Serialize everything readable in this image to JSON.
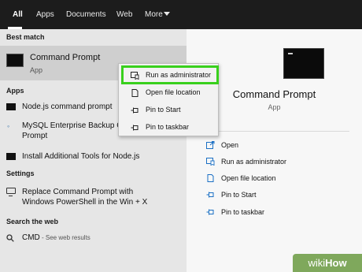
{
  "tabs": [
    {
      "label": "All"
    },
    {
      "label": "Apps"
    },
    {
      "label": "Documents"
    },
    {
      "label": "Web"
    },
    {
      "label": "More"
    }
  ],
  "sections": {
    "best_match": "Best match",
    "apps": "Apps",
    "settings": "Settings",
    "search_web": "Search the web"
  },
  "best_match": {
    "title": "Command Prompt",
    "subtitle": "App"
  },
  "apps": [
    {
      "label": "Node.js command prompt",
      "icon": "console-icon"
    },
    {
      "line1": "MySQL Enterprise Backup Co",
      "line2": "Prompt",
      "icon": "mysql-icon"
    },
    {
      "label": "Install Additional Tools for Node.js",
      "icon": "console-icon"
    }
  ],
  "settings": {
    "line1": "Replace Command Prompt with",
    "line2": "Windows PowerShell in the Win + X",
    "icon": "monitor-icon"
  },
  "web": {
    "query": "CMD",
    "suffix": " - See web results",
    "icon": "search-icon"
  },
  "context_menu": [
    {
      "label": "Run as administrator",
      "icon": "shield-run-icon"
    },
    {
      "label": "Open file location",
      "icon": "document-icon"
    },
    {
      "label": "Pin to Start",
      "icon": "pin-icon"
    },
    {
      "label": "Pin to taskbar",
      "icon": "pin-icon"
    }
  ],
  "preview": {
    "title": "Command Prompt",
    "subtitle": "App"
  },
  "actions": [
    {
      "label": "Open",
      "icon": "open-icon"
    },
    {
      "label": "Run as administrator",
      "icon": "shield-run-icon"
    },
    {
      "label": "Open file location",
      "icon": "document-icon"
    },
    {
      "label": "Pin to Start",
      "icon": "pin-icon"
    },
    {
      "label": "Pin to taskbar",
      "icon": "pin-icon"
    }
  ],
  "watermark": {
    "prefix": "wiki",
    "suffix": "How"
  },
  "colors": {
    "highlight": "#39d01d",
    "accent": "#1a6fc4",
    "topbar": "#1c1c1c"
  }
}
